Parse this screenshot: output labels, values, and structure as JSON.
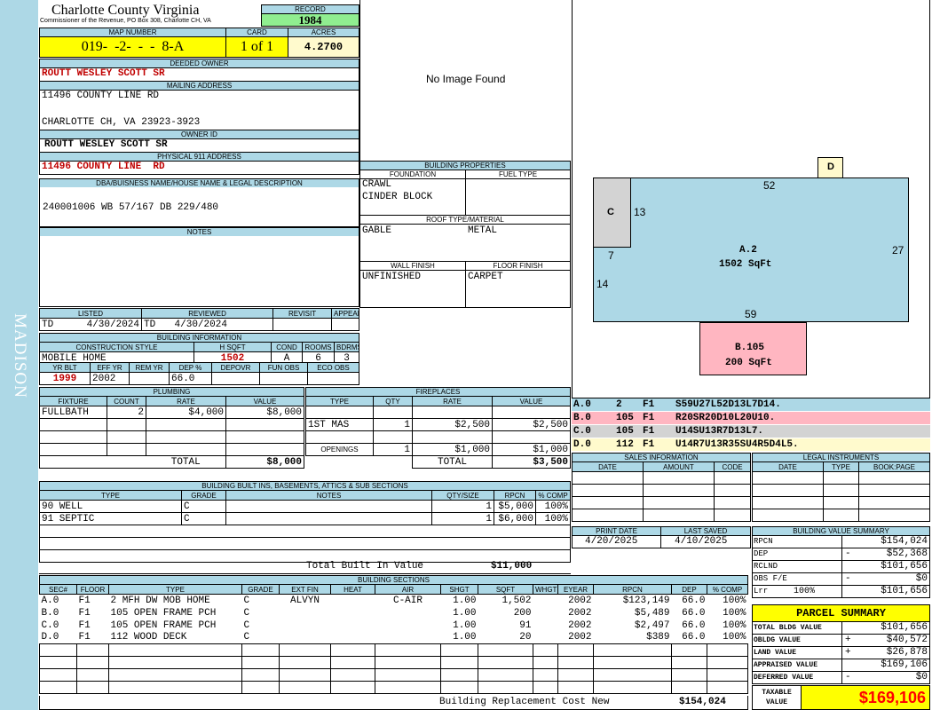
{
  "sidebar": {
    "district": "MADISON"
  },
  "header": {
    "county_name": "Charlotte County Virginia",
    "commissioner": "Commissioner of the Revenue, PO Box 308, Charlotte CH, VA",
    "record_label": "RECORD",
    "record_value": "1984",
    "map_number_label": "MAP NUMBER",
    "map_number": "019-  -2-  -  -  8-A",
    "card_label": "CARD",
    "card_value": "1 of 1",
    "acres_label": "ACRES",
    "acres_value": "4.2700"
  },
  "owner": {
    "deeded_owner_label": "DEEDED OWNER",
    "deeded_owner": "ROUTT WESLEY SCOTT SR",
    "mailing_address_label": "MAILING ADDRESS",
    "mailing_line1": "11496 COUNTY LINE RD",
    "mailing_line2": "CHARLOTTE CH, VA 23923-3923",
    "owner_id_label": "OWNER ID",
    "owner_id": "ROUTT WESLEY SCOTT SR",
    "physical_address_label": "PHYSICAL 911 ADDRESS",
    "physical_address": "11496 COUNTY LINE  RD",
    "legal_label": "DBA/BUISNESS NAME/HOUSE NAME & LEGAL DESCRIPTION",
    "legal_description": "240001006 WB 57/167 DB 229/480",
    "notes_label": "NOTES"
  },
  "photo": {
    "no_image_text": "No Image Found"
  },
  "building_properties": {
    "title": "BUILDING PROPERTIES",
    "foundation_label": "FOUNDATION",
    "fuel_type_label": "FUEL TYPE",
    "foundation_1": "CRAWL",
    "foundation_2": "CINDER BLOCK",
    "roof_label": "ROOF TYPE/MATERIAL",
    "roof_type": "GABLE",
    "roof_material": "METAL",
    "wall_finish_label": "WALL FINISH",
    "floor_finish_label": "FLOOR FINISH",
    "wall_finish": "UNFINISHED",
    "floor_finish": "CARPET"
  },
  "sketch": {
    "d_label": "D",
    "c_label": "C",
    "main_label": "A.2",
    "main_area": "1502 SqFt",
    "dim_top": "52",
    "dim_c": "13",
    "dim_right": "27",
    "dim_left_1": "7",
    "dim_left_2": "14",
    "dim_bottom": "59",
    "b_label": "B.105",
    "b_area": "200 SqFt"
  },
  "sketch_codes": [
    {
      "sec": "A.0",
      "code": "2",
      "floor": "F1",
      "path": "S59U27L52D13L7D14.",
      "color": "#add8e6"
    },
    {
      "sec": "B.0",
      "code": "105",
      "floor": "F1",
      "path": "R20SR20D10L20U10.",
      "color": "#ffb6c1"
    },
    {
      "sec": "C.0",
      "code": "105",
      "floor": "F1",
      "path": "U14SU13R7D13L7.",
      "color": "#d3d3d3"
    },
    {
      "sec": "D.0",
      "code": "112",
      "floor": "F1",
      "path": "U14R7U13R35SU4R5D4L5.",
      "color": "#fffacd"
    }
  ],
  "listing": {
    "listed_label": "LISTED",
    "reviewed_label": "REVIEWED",
    "revisit_label": "REVISIT",
    "appeals_label": "APPEALS",
    "listed_by": "TD",
    "listed_date": "4/30/2024",
    "reviewed_by": "TD",
    "reviewed_date": "4/30/2024"
  },
  "building_info": {
    "title": "BUILDING INFORMATION",
    "construction_label": "CONSTRUCTION STYLE",
    "hsqft_label": "H SQFT",
    "cond_label": "COND",
    "rooms_label": "ROOMS",
    "bdrms_label": "BDRMS",
    "construction": "MOBILE HOME",
    "hsqft": "1502",
    "cond": "A",
    "rooms": "6",
    "bdrms": "3",
    "yrblt_label": "YR BLT",
    "effyr_label": "EFF YR",
    "remyr_label": "REM YR",
    "dep_label": "DEP %",
    "depovr_label": "DEPOVR",
    "funobs_label": "FUN OBS",
    "ecoobs_label": "ECO OBS",
    "yrblt": "1999",
    "effyr": "2002",
    "dep": "66.0"
  },
  "plumbing": {
    "title": "PLUMBING",
    "headers": [
      "FIXTURE",
      "COUNT",
      "RATE",
      "VALUE"
    ],
    "rows": [
      [
        "FULLBATH",
        "2",
        "$4,000",
        "$8,000"
      ]
    ],
    "total_label": "TOTAL",
    "total": "$8,000"
  },
  "fireplaces": {
    "title": "FIREPLACES",
    "headers": [
      "TYPE",
      "QTY",
      "RATE",
      "VALUE"
    ],
    "rows": [
      [
        "1ST MAS",
        "1",
        "$2,500",
        "$2,500"
      ]
    ],
    "openings_label": "OPENINGS",
    "openings_qty": "1",
    "openings_rate": "$1,000",
    "openings_value": "$1,000",
    "total_label": "TOTAL",
    "total": "$3,500"
  },
  "built_ins": {
    "title": "BUILDING BUILT INS, BASEMENTS, ATTICS & SUB SECTIONS",
    "headers": [
      "TYPE",
      "GRADE",
      "NOTES",
      "QTY/SIZE",
      "RPCN",
      "% COMP"
    ],
    "rows": [
      [
        "90 WELL",
        "C",
        "",
        "1",
        "$5,000",
        "100%"
      ],
      [
        "91 SEPTIC",
        "C",
        "",
        "1",
        "$6,000",
        "100%"
      ]
    ],
    "total_label": "Total Built In Value",
    "total": "$11,000"
  },
  "sales": {
    "title": "SALES INFORMATION",
    "headers": [
      "DATE",
      "AMOUNT",
      "CODE"
    ]
  },
  "legal_instruments": {
    "title": "LEGAL INSTRUMENTS",
    "headers": [
      "DATE",
      "TYPE",
      "BOOK:PAGE"
    ]
  },
  "dates": {
    "print_label": "PRINT DATE",
    "print_date": "4/20/2025",
    "saved_label": "LAST SAVED",
    "saved_date": "4/10/2025"
  },
  "building_sections": {
    "title": "BUILDING SECTIONS",
    "headers": [
      "SEC#",
      "FLOOR",
      "TYPE",
      "GRADE",
      "EXT FIN",
      "HEAT",
      "AIR",
      "SHGT",
      "SQFT",
      "WHGT",
      "EYEAR",
      "RPCN",
      "DEP",
      "% COMP"
    ],
    "rows": [
      [
        "A.0",
        "F1",
        "2 MFH DW MOB HOME",
        "C",
        "ALVYN",
        "",
        "C-AIR",
        "1.00",
        "1,502",
        "",
        "2002",
        "$123,149",
        "66.0",
        "100%"
      ],
      [
        "B.0",
        "F1",
        "105 OPEN FRAME PCH",
        "C",
        "",
        "",
        "",
        "1.00",
        "200",
        "",
        "2002",
        "$5,489",
        "66.0",
        "100%"
      ],
      [
        "C.0",
        "F1",
        "105 OPEN FRAME PCH",
        "C",
        "",
        "",
        "",
        "1.00",
        "91",
        "",
        "2002",
        "$2,497",
        "66.0",
        "100%"
      ],
      [
        "D.0",
        "F1",
        "112 WOOD DECK",
        "C",
        "",
        "",
        "",
        "1.00",
        "20",
        "",
        "2002",
        "$389",
        "66.0",
        "100%"
      ]
    ],
    "total_label": "Building Replacement Cost New",
    "total": "$154,024"
  },
  "value_summary": {
    "title": "BUILDING VALUE SUMMARY",
    "rows": [
      {
        "label": "RPCN",
        "pct": "",
        "sign": "",
        "value": "$154,024"
      },
      {
        "label": "DEP",
        "pct": "",
        "sign": "-",
        "value": "$52,368"
      },
      {
        "label": "RCLND",
        "pct": "",
        "sign": "",
        "value": "$101,656"
      },
      {
        "label": "OBS F/E",
        "pct": "",
        "sign": "-",
        "value": "$0"
      },
      {
        "label": "Lrr",
        "pct": "100%",
        "sign": "",
        "value": "$101,656"
      }
    ]
  },
  "parcel_summary": {
    "title": "PARCEL SUMMARY",
    "rows": [
      {
        "label": "TOTAL BLDG VALUE",
        "sign": "",
        "value": "$101,656"
      },
      {
        "label": "OBLDG VALUE",
        "sign": "+",
        "value": "$40,572"
      },
      {
        "label": "LAND VALUE",
        "sign": "+",
        "value": "$26,878"
      },
      {
        "label": "APPRAISED VALUE",
        "sign": "",
        "value": "$169,106"
      },
      {
        "label": "DEFERRED VALUE",
        "sign": "-",
        "value": "$0"
      }
    ],
    "taxable_label": "TAXABLE VALUE",
    "taxable_value": "$169,106"
  }
}
